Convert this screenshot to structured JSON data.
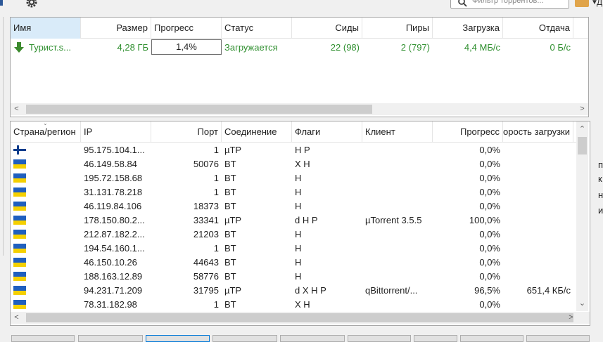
{
  "app": {
    "filter_placeholder": "Фильтр торрентов..."
  },
  "colors": {
    "accent_blue": "#0078d7",
    "status_green": "#2f8f2f",
    "sorted_header": "#d9ebf9",
    "flag_ua_blue": "#1f5fbf",
    "flag_ua_yellow": "#f5d000",
    "flag_fi_blue": "#0d3c8c"
  },
  "torrents": {
    "columns": [
      "Имя",
      "Размер",
      "Прогресс",
      "Статус",
      "Сиды",
      "Пиры",
      "Загрузка",
      "Отдача"
    ],
    "rows": [
      {
        "icon": "download-arrow-icon",
        "name": "Турист.s...",
        "size": "4,28 ГБ",
        "progress": "1,4%",
        "status": "Загружается",
        "seeds": "22 (98)",
        "peers": "2 (797)",
        "download": "4,4 МБ/с",
        "upload": "0 Б/с"
      }
    ]
  },
  "peers": {
    "columns": [
      "Страна/регион",
      "IP",
      "Порт",
      "Соединение",
      "Флаги",
      "Клиент",
      "Прогресс",
      "Скорость загрузки"
    ],
    "rows": [
      {
        "flag": "fi",
        "ip": "95.175.104.1...",
        "port": "1",
        "conn": "µTP",
        "flags": "H P",
        "client": "",
        "progress": "0,0%",
        "speed": ""
      },
      {
        "flag": "ua",
        "ip": "46.149.58.84",
        "port": "50076",
        "conn": "BT",
        "flags": "X H",
        "client": "",
        "progress": "0,0%",
        "speed": ""
      },
      {
        "flag": "ua",
        "ip": "195.72.158.68",
        "port": "1",
        "conn": "BT",
        "flags": "H",
        "client": "",
        "progress": "0,0%",
        "speed": ""
      },
      {
        "flag": "ua",
        "ip": "31.131.78.218",
        "port": "1",
        "conn": "BT",
        "flags": "H",
        "client": "",
        "progress": "0,0%",
        "speed": ""
      },
      {
        "flag": "ua",
        "ip": "46.119.84.106",
        "port": "18373",
        "conn": "BT",
        "flags": "H",
        "client": "",
        "progress": "0,0%",
        "speed": ""
      },
      {
        "flag": "ua",
        "ip": "178.150.80.2...",
        "port": "33341",
        "conn": "µTP",
        "flags": "d H P",
        "client": "µTorrent 3.5.5",
        "progress": "100,0%",
        "speed": ""
      },
      {
        "flag": "ua",
        "ip": "212.87.182.2...",
        "port": "21203",
        "conn": "BT",
        "flags": "H",
        "client": "",
        "progress": "0,0%",
        "speed": ""
      },
      {
        "flag": "ua",
        "ip": "194.54.160.1...",
        "port": "1",
        "conn": "BT",
        "flags": "H",
        "client": "",
        "progress": "0,0%",
        "speed": ""
      },
      {
        "flag": "ua",
        "ip": "46.150.10.26",
        "port": "44643",
        "conn": "BT",
        "flags": "H",
        "client": "",
        "progress": "0,0%",
        "speed": ""
      },
      {
        "flag": "ua",
        "ip": "188.163.12.89",
        "port": "58776",
        "conn": "BT",
        "flags": "H",
        "client": "",
        "progress": "0,0%",
        "speed": ""
      },
      {
        "flag": "ua",
        "ip": "94.231.71.209",
        "port": "31795",
        "conn": "µTP",
        "flags": "d X H P",
        "client": "qBittorrent/...",
        "progress": "96,5%",
        "speed": "651,4 КБ/с"
      },
      {
        "flag": "ua",
        "ip": "78.31.182.98",
        "port": "1",
        "conn": "BT",
        "flags": "X H",
        "client": "",
        "progress": "0,0%",
        "speed": ""
      }
    ]
  },
  "right_residue": [
    "п",
    "к",
    "н",
    "и"
  ]
}
